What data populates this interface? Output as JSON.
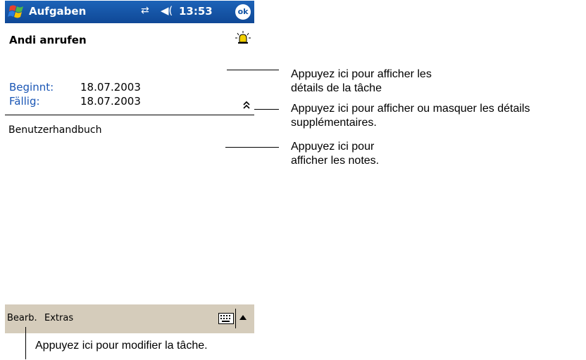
{
  "titlebar": {
    "app_title": "Aufgaben",
    "time": "13:53",
    "ok_label": "ok",
    "start_icon": "windows-flag-icon",
    "connection_icon": "connectivity-icon",
    "volume_icon": "speaker-icon"
  },
  "task": {
    "title": "Andi anrufen",
    "alarm_icon": "alarm-bell-icon",
    "start_label": "Beginnt:",
    "start_date": "18.07.2003",
    "due_label": "Fällig:",
    "due_date": "18.07.2003",
    "toggle_icon": "double-chevron-up-icon",
    "notes": "Benutzerhandbuch"
  },
  "menubar": {
    "edit": "Bearb.",
    "tools": "Extras",
    "keyboard_icon": "keyboard-icon",
    "input_arrow_icon": "triangle-up-icon"
  },
  "annotations": {
    "details_line1": "Appuyez ici pour afficher les",
    "details_line2": "détails de la tâche",
    "toggle_line1": "Appuyez ici pour afficher ou masquer les détails",
    "toggle_line2": "supplémentaires.",
    "notes_line1": "Appuyez ici pour",
    "notes_line2": "afficher les notes.",
    "edit_note": "Appuyez ici pour modifier la tâche."
  }
}
